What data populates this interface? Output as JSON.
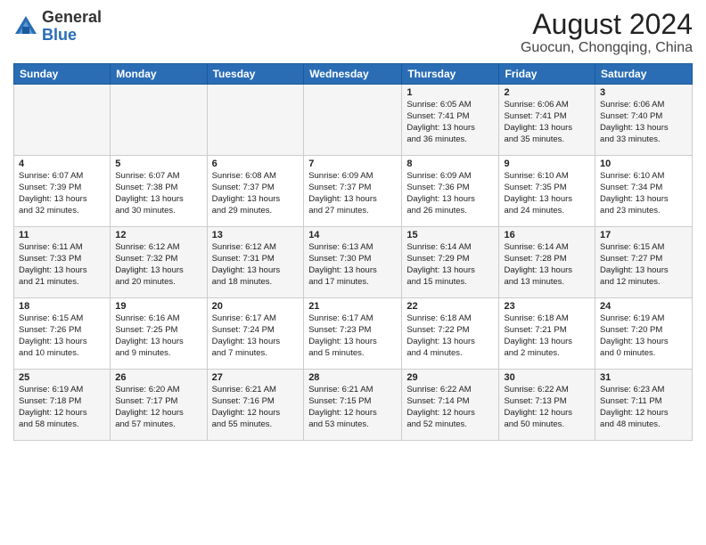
{
  "header": {
    "logo_general": "General",
    "logo_blue": "Blue",
    "month_year": "August 2024",
    "location": "Guocun, Chongqing, China"
  },
  "weekdays": [
    "Sunday",
    "Monday",
    "Tuesday",
    "Wednesday",
    "Thursday",
    "Friday",
    "Saturday"
  ],
  "weeks": [
    [
      {
        "day": "",
        "info": ""
      },
      {
        "day": "",
        "info": ""
      },
      {
        "day": "",
        "info": ""
      },
      {
        "day": "",
        "info": ""
      },
      {
        "day": "1",
        "info": "Sunrise: 6:05 AM\nSunset: 7:41 PM\nDaylight: 13 hours\nand 36 minutes."
      },
      {
        "day": "2",
        "info": "Sunrise: 6:06 AM\nSunset: 7:41 PM\nDaylight: 13 hours\nand 35 minutes."
      },
      {
        "day": "3",
        "info": "Sunrise: 6:06 AM\nSunset: 7:40 PM\nDaylight: 13 hours\nand 33 minutes."
      }
    ],
    [
      {
        "day": "4",
        "info": "Sunrise: 6:07 AM\nSunset: 7:39 PM\nDaylight: 13 hours\nand 32 minutes."
      },
      {
        "day": "5",
        "info": "Sunrise: 6:07 AM\nSunset: 7:38 PM\nDaylight: 13 hours\nand 30 minutes."
      },
      {
        "day": "6",
        "info": "Sunrise: 6:08 AM\nSunset: 7:37 PM\nDaylight: 13 hours\nand 29 minutes."
      },
      {
        "day": "7",
        "info": "Sunrise: 6:09 AM\nSunset: 7:37 PM\nDaylight: 13 hours\nand 27 minutes."
      },
      {
        "day": "8",
        "info": "Sunrise: 6:09 AM\nSunset: 7:36 PM\nDaylight: 13 hours\nand 26 minutes."
      },
      {
        "day": "9",
        "info": "Sunrise: 6:10 AM\nSunset: 7:35 PM\nDaylight: 13 hours\nand 24 minutes."
      },
      {
        "day": "10",
        "info": "Sunrise: 6:10 AM\nSunset: 7:34 PM\nDaylight: 13 hours\nand 23 minutes."
      }
    ],
    [
      {
        "day": "11",
        "info": "Sunrise: 6:11 AM\nSunset: 7:33 PM\nDaylight: 13 hours\nand 21 minutes."
      },
      {
        "day": "12",
        "info": "Sunrise: 6:12 AM\nSunset: 7:32 PM\nDaylight: 13 hours\nand 20 minutes."
      },
      {
        "day": "13",
        "info": "Sunrise: 6:12 AM\nSunset: 7:31 PM\nDaylight: 13 hours\nand 18 minutes."
      },
      {
        "day": "14",
        "info": "Sunrise: 6:13 AM\nSunset: 7:30 PM\nDaylight: 13 hours\nand 17 minutes."
      },
      {
        "day": "15",
        "info": "Sunrise: 6:14 AM\nSunset: 7:29 PM\nDaylight: 13 hours\nand 15 minutes."
      },
      {
        "day": "16",
        "info": "Sunrise: 6:14 AM\nSunset: 7:28 PM\nDaylight: 13 hours\nand 13 minutes."
      },
      {
        "day": "17",
        "info": "Sunrise: 6:15 AM\nSunset: 7:27 PM\nDaylight: 13 hours\nand 12 minutes."
      }
    ],
    [
      {
        "day": "18",
        "info": "Sunrise: 6:15 AM\nSunset: 7:26 PM\nDaylight: 13 hours\nand 10 minutes."
      },
      {
        "day": "19",
        "info": "Sunrise: 6:16 AM\nSunset: 7:25 PM\nDaylight: 13 hours\nand 9 minutes."
      },
      {
        "day": "20",
        "info": "Sunrise: 6:17 AM\nSunset: 7:24 PM\nDaylight: 13 hours\nand 7 minutes."
      },
      {
        "day": "21",
        "info": "Sunrise: 6:17 AM\nSunset: 7:23 PM\nDaylight: 13 hours\nand 5 minutes."
      },
      {
        "day": "22",
        "info": "Sunrise: 6:18 AM\nSunset: 7:22 PM\nDaylight: 13 hours\nand 4 minutes."
      },
      {
        "day": "23",
        "info": "Sunrise: 6:18 AM\nSunset: 7:21 PM\nDaylight: 13 hours\nand 2 minutes."
      },
      {
        "day": "24",
        "info": "Sunrise: 6:19 AM\nSunset: 7:20 PM\nDaylight: 13 hours\nand 0 minutes."
      }
    ],
    [
      {
        "day": "25",
        "info": "Sunrise: 6:19 AM\nSunset: 7:18 PM\nDaylight: 12 hours\nand 58 minutes."
      },
      {
        "day": "26",
        "info": "Sunrise: 6:20 AM\nSunset: 7:17 PM\nDaylight: 12 hours\nand 57 minutes."
      },
      {
        "day": "27",
        "info": "Sunrise: 6:21 AM\nSunset: 7:16 PM\nDaylight: 12 hours\nand 55 minutes."
      },
      {
        "day": "28",
        "info": "Sunrise: 6:21 AM\nSunset: 7:15 PM\nDaylight: 12 hours\nand 53 minutes."
      },
      {
        "day": "29",
        "info": "Sunrise: 6:22 AM\nSunset: 7:14 PM\nDaylight: 12 hours\nand 52 minutes."
      },
      {
        "day": "30",
        "info": "Sunrise: 6:22 AM\nSunset: 7:13 PM\nDaylight: 12 hours\nand 50 minutes."
      },
      {
        "day": "31",
        "info": "Sunrise: 6:23 AM\nSunset: 7:11 PM\nDaylight: 12 hours\nand 48 minutes."
      }
    ]
  ]
}
